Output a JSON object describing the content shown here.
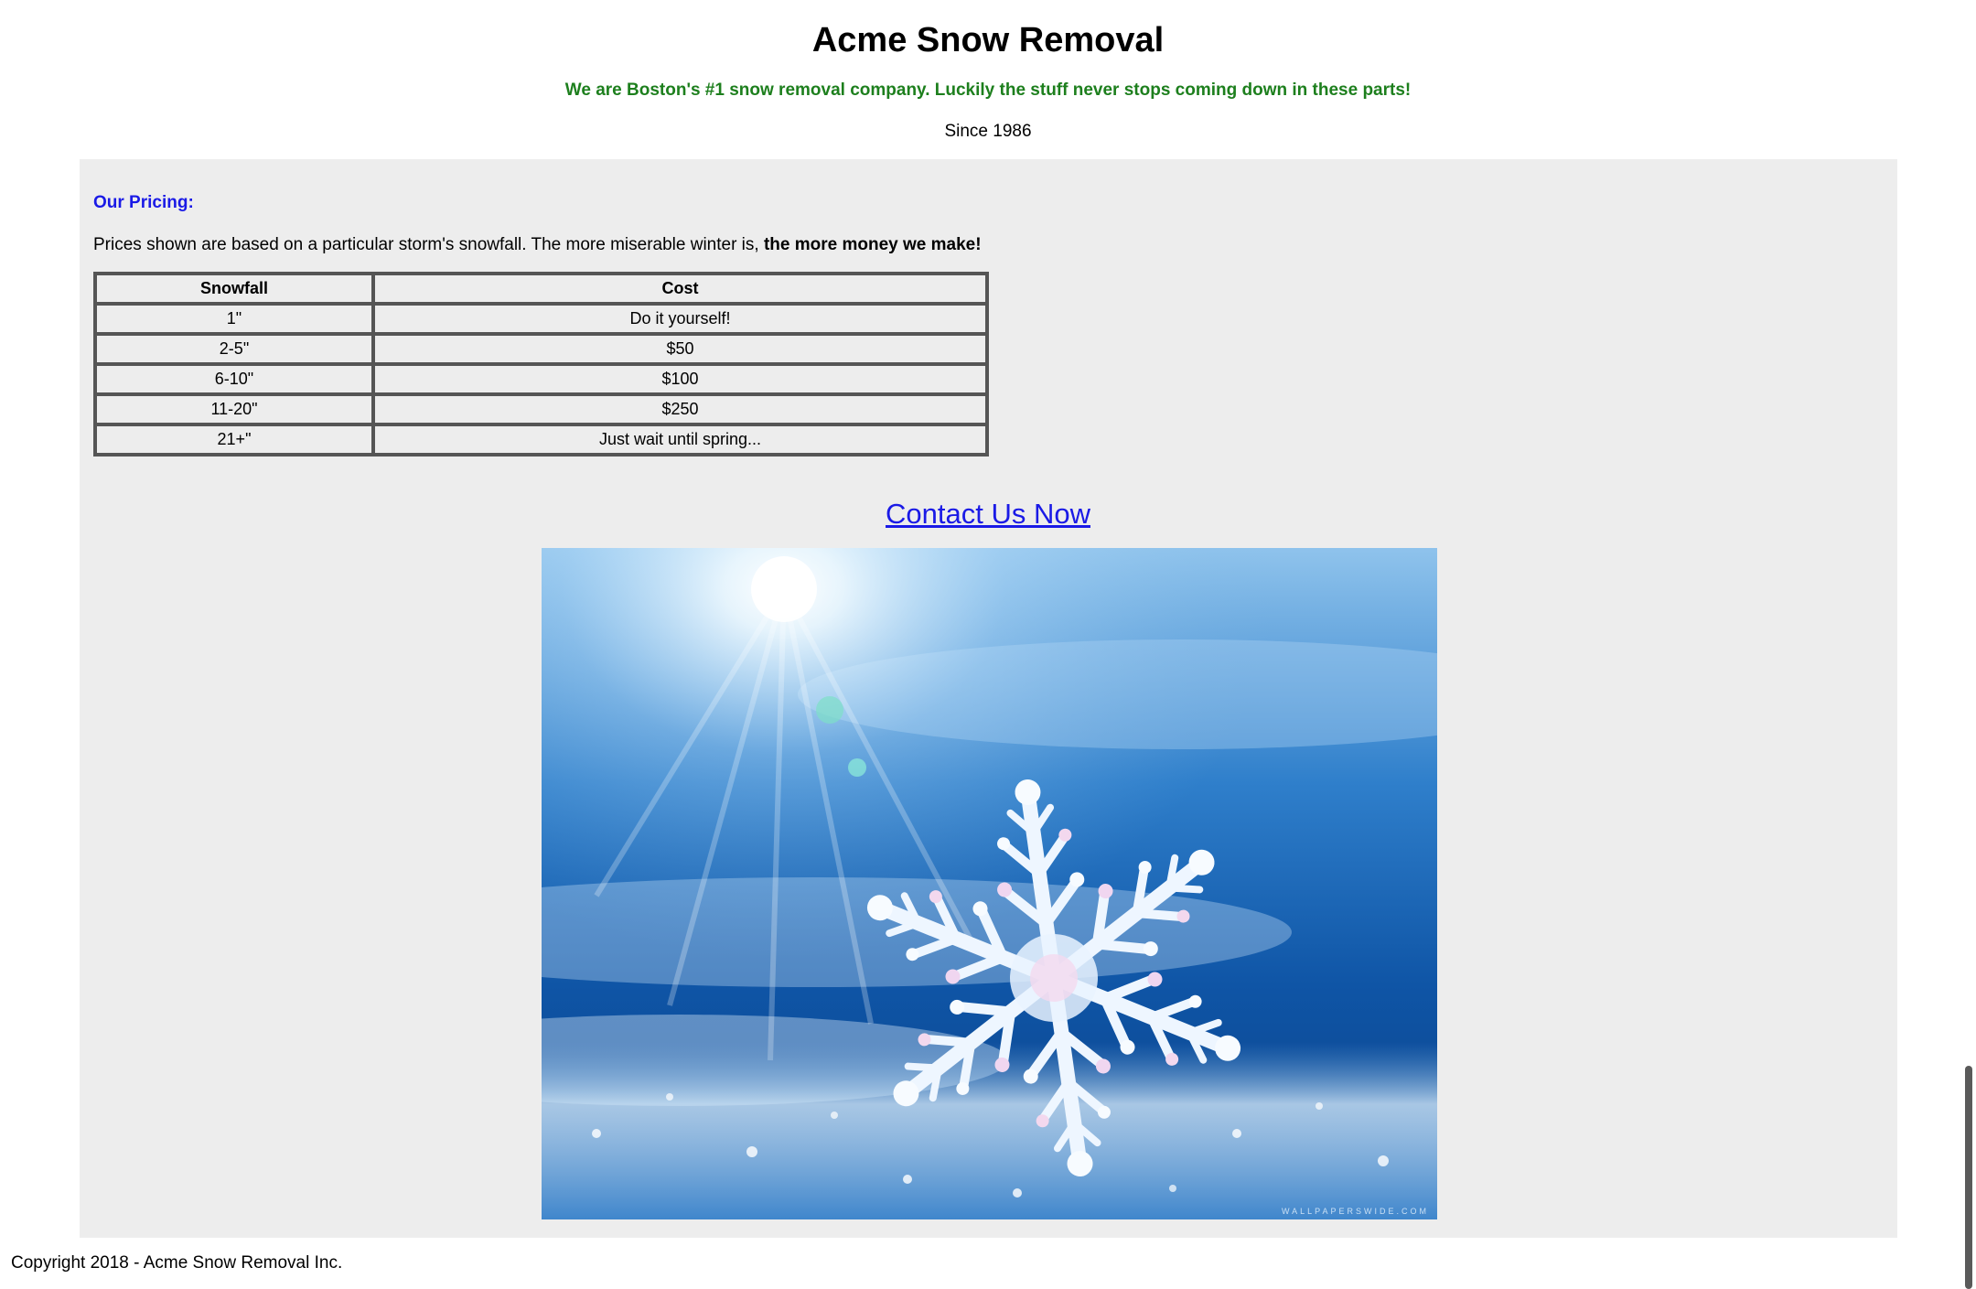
{
  "header": {
    "title": "Acme Snow Removal",
    "tagline": "We are Boston's #1 snow removal company. Luckily the stuff never stops coming down in these parts!",
    "since": "Since 1986"
  },
  "pricing": {
    "heading": "Our Pricing:",
    "description": "Prices shown are based on a particular storm's snowfall. The more miserable winter is,",
    "description_bold": " the more money we make!",
    "columns": [
      "Snowfall",
      "Cost"
    ],
    "rows": [
      [
        "1\"",
        "Do it yourself!"
      ],
      [
        "2-5\"",
        "$50"
      ],
      [
        "6-10\"",
        "$100"
      ],
      [
        "11-20\"",
        "$250"
      ],
      [
        "21+\"",
        "Just wait until spring..."
      ]
    ]
  },
  "contact": {
    "label": "Contact Us Now"
  },
  "hero_image": {
    "icon": "snowflake-photo",
    "watermark": "WALLPAPERSWIDE.COM"
  },
  "footer": {
    "copyright": "Copyright 2018 - Acme Snow Removal Inc."
  },
  "colors": {
    "tagline": "#1d7f1d",
    "link": "#1a1ae6",
    "panel": "#ededed",
    "table_border": "#555555"
  }
}
